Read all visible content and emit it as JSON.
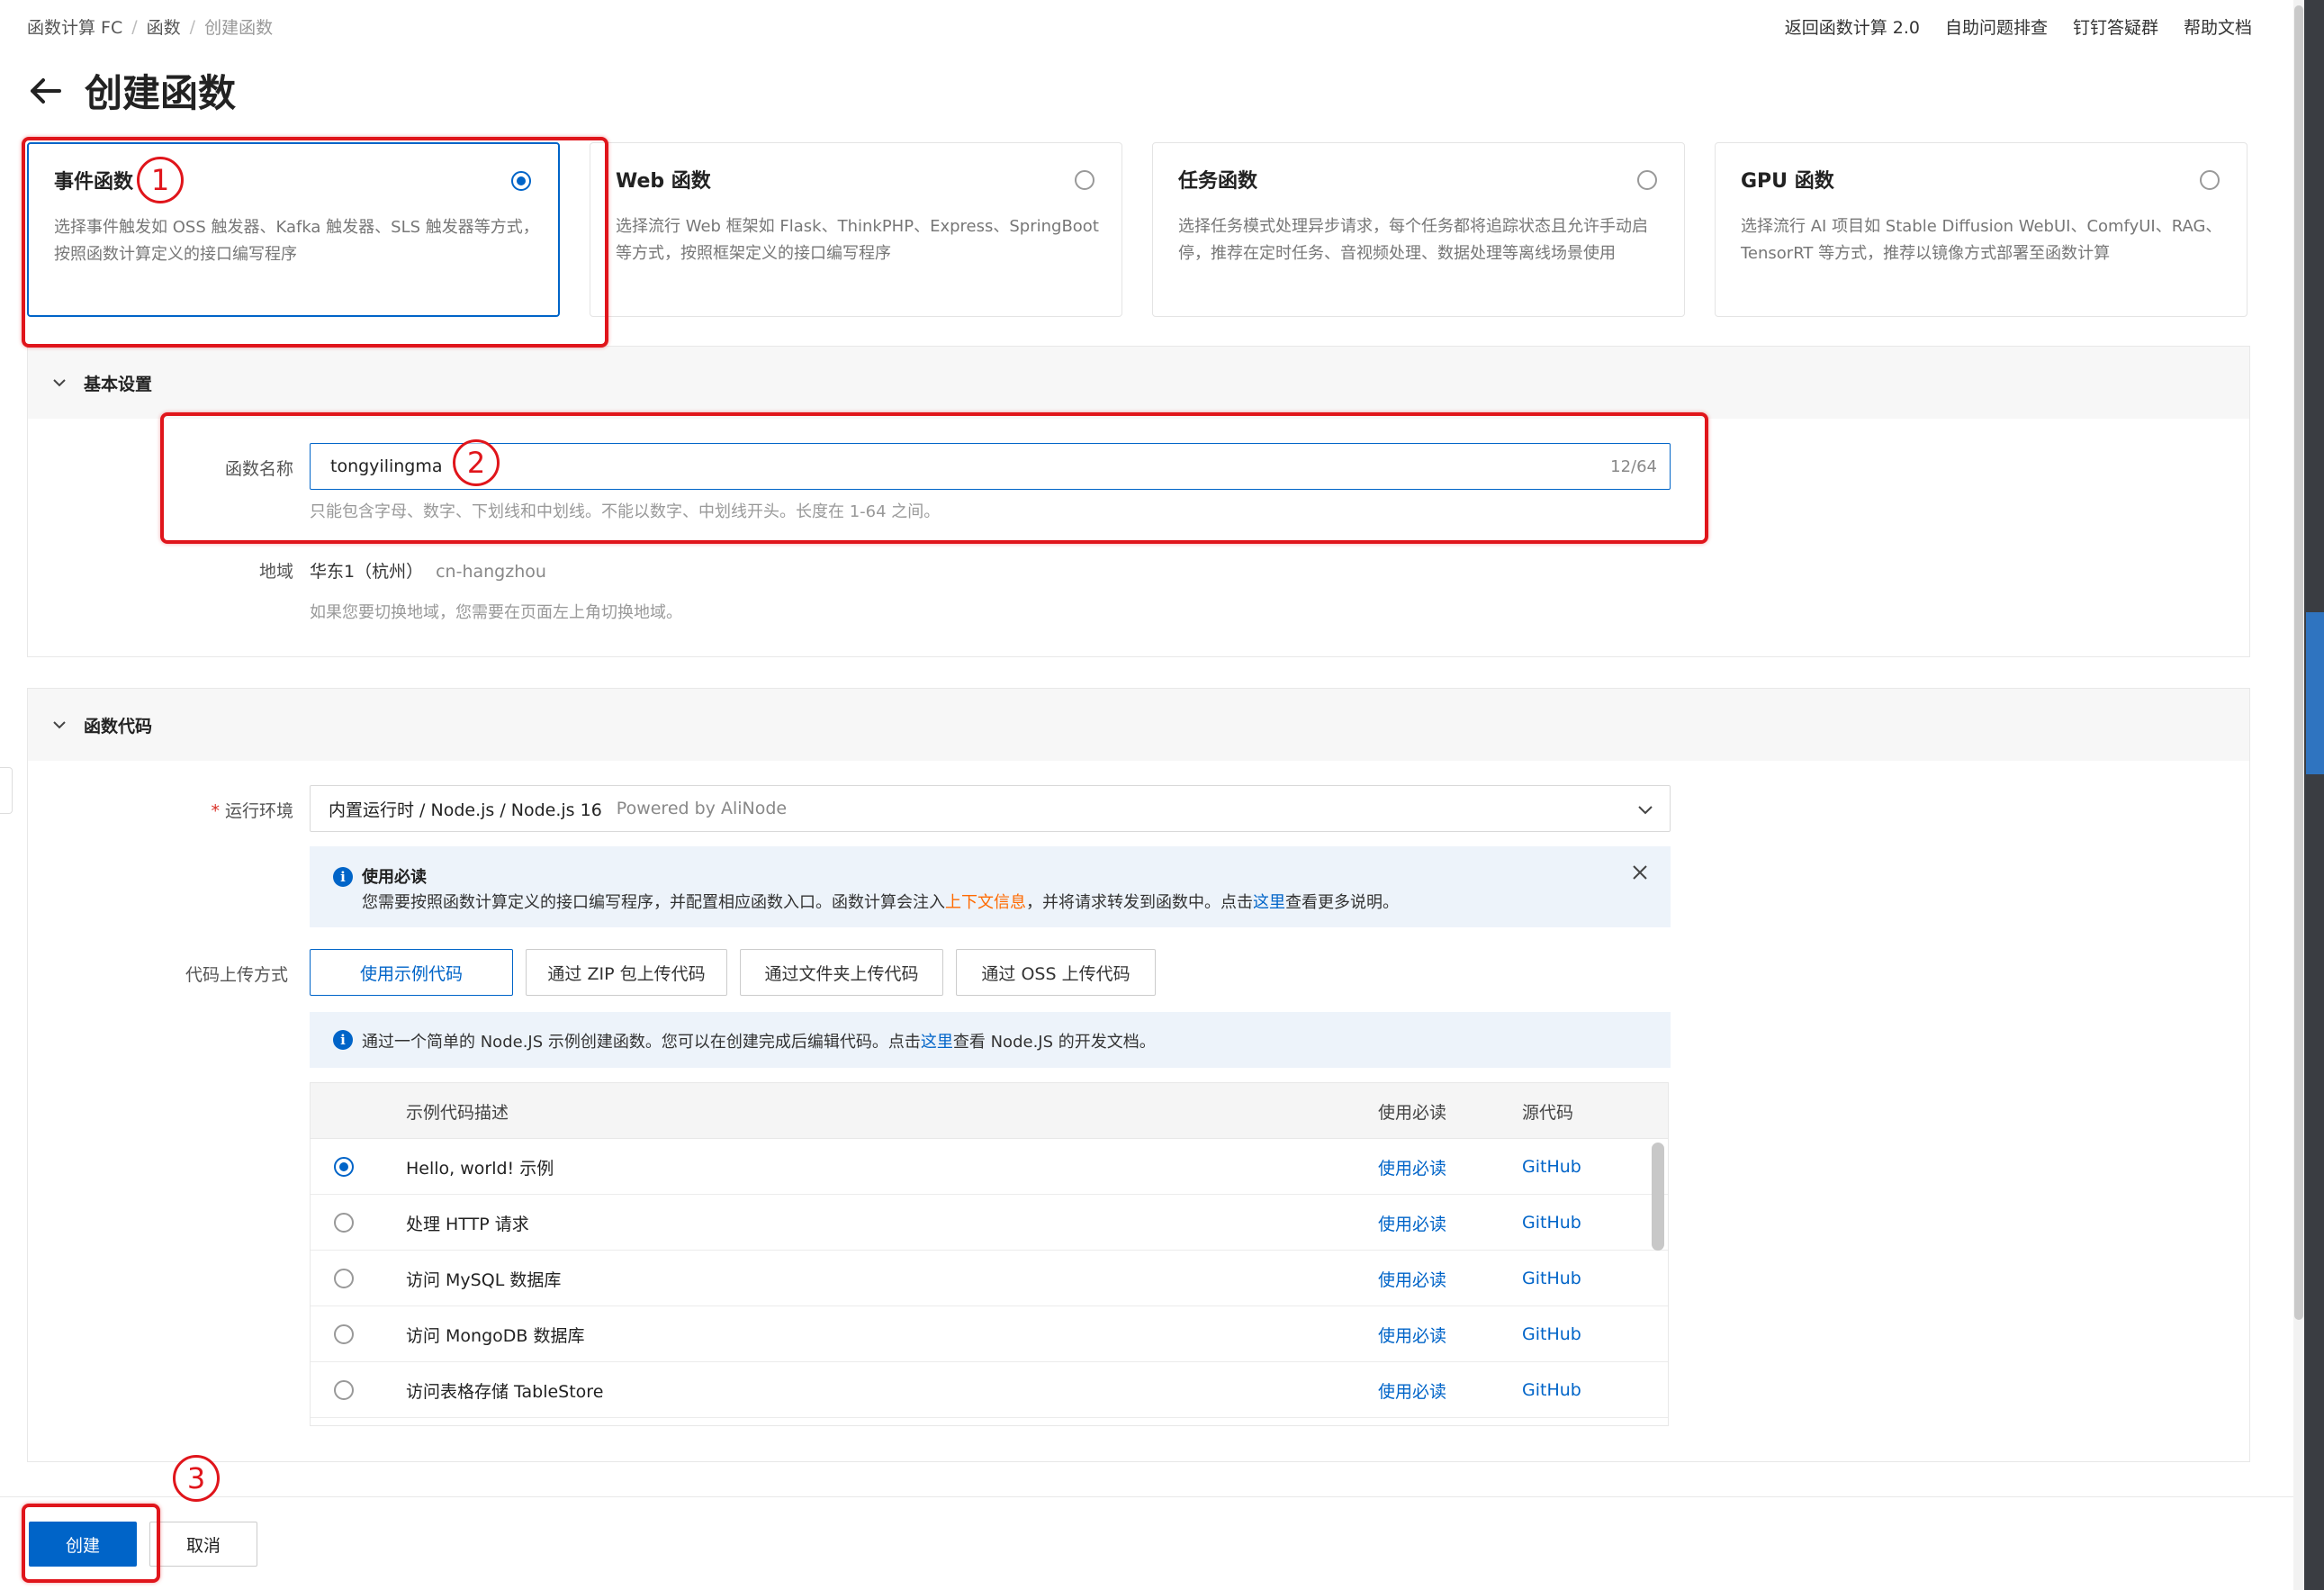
{
  "breadcrumb": [
    "函数计算 FC",
    "函数",
    "创建函数"
  ],
  "top_links": [
    "返回函数计算 2.0",
    "自助问题排查",
    "钉钉答疑群",
    "帮助文档"
  ],
  "page_title": "创建函数",
  "function_types": [
    {
      "title": "事件函数",
      "desc": "选择事件触发如 OSS 触发器、Kafka 触发器、SLS 触发器等方式，按照函数计算定义的接口编写程序",
      "selected": true
    },
    {
      "title": "Web 函数",
      "desc": "选择流行 Web 框架如 Flask、ThinkPHP、Express、SpringBoot 等方式，按照框架定义的接口编写程序",
      "selected": false
    },
    {
      "title": "任务函数",
      "desc": "选择任务模式处理异步请求，每个任务都将追踪状态且允许手动启停，推荐在定时任务、音视频处理、数据处理等离线场景使用",
      "selected": false
    },
    {
      "title": "GPU 函数",
      "desc": "选择流行 AI 项目如 Stable Diffusion WebUI、ComfyUI、RAG、TensorRT 等方式，推荐以镜像方式部署至函数计算",
      "selected": false
    }
  ],
  "basic": {
    "section_title": "基本设置",
    "name_label": "函数名称",
    "name_value": "tongyilingma",
    "name_count": "12/64",
    "name_hint": "只能包含字母、数字、下划线和中划线。不能以数字、中划线开头。长度在 1-64 之间。",
    "region_label": "地域",
    "region_value": "华东1（杭州）",
    "region_code": "cn-hangzhou",
    "region_hint": "如果您要切换地域，您需要在页面左上角切换地域。"
  },
  "code": {
    "section_title": "函数代码",
    "runtime_label": "运行环境",
    "runtime_required": "*",
    "runtime_value": "内置运行时 / Node.js / Node.js 16",
    "runtime_powered": "Powered by AliNode",
    "notice_title": "使用必读",
    "notice_text_a": "您需要按照函数计算定义的接口编写程序，并配置相应函数入口。函数计算会注入",
    "notice_link_context": "上下文信息",
    "notice_text_b": "，并将请求转发到函数中。点击",
    "notice_link_here": "这里",
    "notice_text_c": "查看更多说明。",
    "upload_label": "代码上传方式",
    "upload_options": [
      "使用示例代码",
      "通过 ZIP 包上传代码",
      "通过文件夹上传代码",
      "通过 OSS 上传代码"
    ],
    "sample_notice_a": "通过一个简单的 Node.JS 示例创建函数。您可以在创建完成后编辑代码。点击",
    "sample_notice_link": "这里",
    "sample_notice_b": "查看 Node.JS 的开发文档。",
    "table_headers": [
      "示例代码描述",
      "使用必读",
      "源代码"
    ],
    "samples": [
      {
        "desc": "Hello, world! 示例",
        "guide": "使用必读",
        "source": "GitHub",
        "selected": true
      },
      {
        "desc": "处理 HTTP 请求",
        "guide": "使用必读",
        "source": "GitHub",
        "selected": false
      },
      {
        "desc": "访问 MySQL 数据库",
        "guide": "使用必读",
        "source": "GitHub",
        "selected": false
      },
      {
        "desc": "访问 MongoDB 数据库",
        "guide": "使用必读",
        "source": "GitHub",
        "selected": false
      },
      {
        "desc": "访问表格存储 TableStore",
        "guide": "使用必读",
        "source": "GitHub",
        "selected": false
      }
    ]
  },
  "footer": {
    "create": "创建",
    "cancel": "取消"
  },
  "annotations": [
    "1",
    "2",
    "3"
  ],
  "colors": {
    "primary": "#0064c8",
    "annotation": "#e0151b",
    "link_orange": "#ff6a00"
  }
}
